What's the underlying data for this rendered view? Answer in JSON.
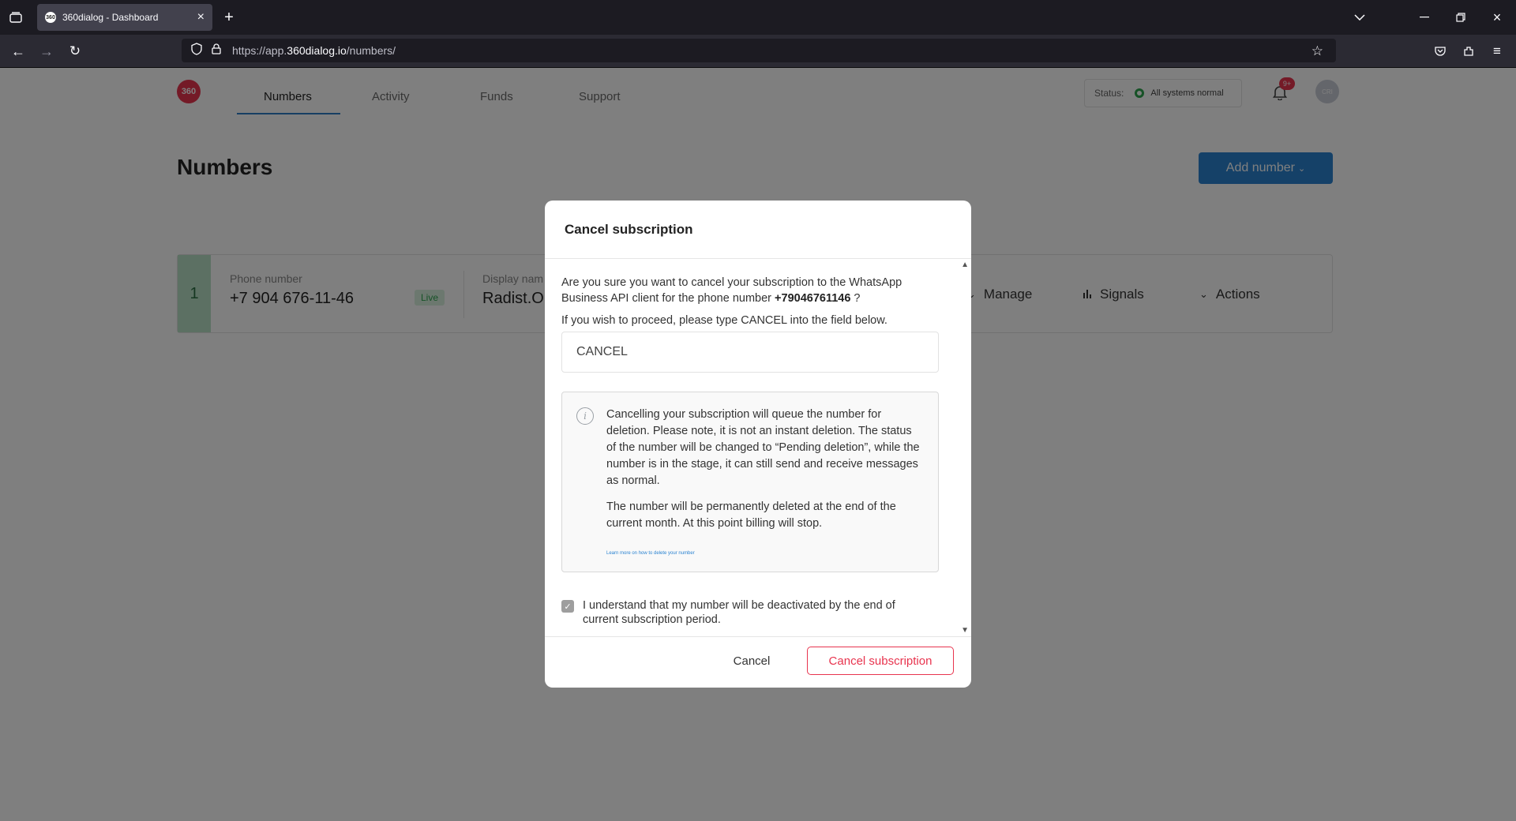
{
  "browser": {
    "tab_favicon": "360",
    "tab_title": "360dialog - Dashboard",
    "url_prefix": "https://app.",
    "url_domain": "360dialog.io",
    "url_path": "/numbers/"
  },
  "app": {
    "logo_text": "360",
    "nav": [
      "Numbers",
      "Activity",
      "Funds",
      "Support"
    ],
    "status_label": "Status:",
    "status_text": "All systems normal",
    "notification_badge": "9+",
    "avatar_initials": "CRI",
    "page_title": "Numbers",
    "add_number_label": "Add number",
    "number_card": {
      "index": "1",
      "phone_label": "Phone number",
      "phone_value": "+7 904 676-11-46",
      "live_badge": "Live",
      "display_label": "Display nam",
      "display_value": "Radist.O",
      "manage_label": "Manage",
      "signals_label": "Signals",
      "actions_label": "Actions"
    }
  },
  "modal": {
    "title": "Cancel subscription",
    "question_pre": "Are you sure you want to cancel your subscription to the WhatsApp Business API client for the phone number ",
    "phone": "+79046761146",
    "question_post": " ?",
    "instruction": "If you wish to proceed, please type CANCEL into the field below.",
    "input_value": "CANCEL",
    "info_p1": "Cancelling your subscription will queue the number for deletion. Please note, it is not an instant deletion. The status of the number will be changed to “Pending deletion”, while the number is in the stage, it can still send and receive messages as normal.",
    "info_p2": "The number will be permanently deleted at the end of the current month. At this point billing will stop.",
    "info_link": "Learn more on how to delete your number",
    "consent": "I understand that my number will be deactivated by the end of current subscription period.",
    "consent_checked": true,
    "cancel_label": "Cancel",
    "confirm_label": "Cancel subscription"
  },
  "colors": {
    "brand": "#e8344e",
    "primary": "#2b83d1",
    "success": "#2ea44f"
  }
}
